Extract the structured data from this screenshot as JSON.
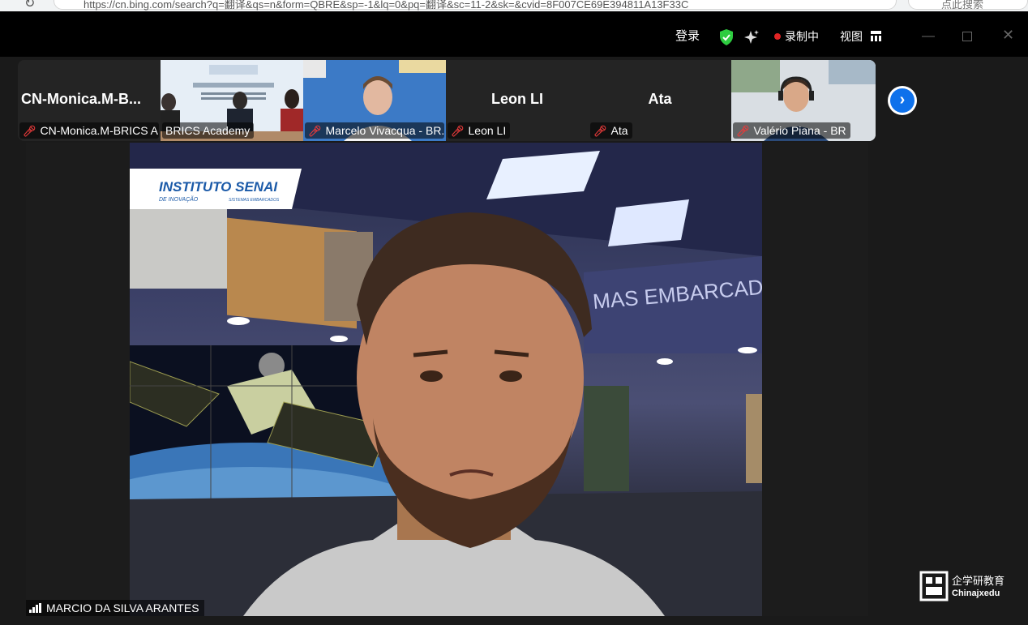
{
  "browser": {
    "url_text": "https://cn.bing.com/search?q=翻译&qs=n&form=QBRE&sp=-1&lq=0&pq=翻译&sc=11-2&sk=&cvid=8F007CE69E394811A13F33C",
    "search_placeholder": "点此搜索"
  },
  "titlebar": {
    "login_label": "登录",
    "recording_label": "录制中",
    "view_label": "视图",
    "shield_icon": "shield-check-icon",
    "sparkle_icon": "ai-companion-icon",
    "recording_color": "#e02424"
  },
  "participants": [
    {
      "display_name": "CN-Monica.M-B...",
      "label": "CN-Monica.M-BRICS A...",
      "muted": true,
      "video": false
    },
    {
      "display_name": "",
      "label": "BRICS Academy",
      "muted": false,
      "video": true
    },
    {
      "display_name": "",
      "label": "Marcelo Vivacqua - BR...",
      "muted": true,
      "video": true
    },
    {
      "display_name": "Leon LI",
      "label": "Leon LI",
      "muted": true,
      "video": false
    },
    {
      "display_name": "Ata",
      "label": "Ata",
      "muted": true,
      "video": false
    },
    {
      "display_name": "",
      "label": "Valério Piana - BR",
      "muted": true,
      "video": true
    }
  ],
  "active_speaker": {
    "name": "MARCIO DA SILVA ARANTES",
    "background_text_brand": "INSTITUTO SENAI",
    "background_text_sub": "DE INOVAÇÃO",
    "background_text_sub2": "SISTEMAS EMBARCADOS",
    "background_wall_text": "MAS EMBARCAD"
  },
  "watermark": {
    "cn": "企学研教育",
    "en": "Chinajxedu"
  },
  "colors": {
    "accent_blue": "#0e71eb",
    "muted_red": "#e83a3a",
    "shield_green": "#2ecc40"
  }
}
